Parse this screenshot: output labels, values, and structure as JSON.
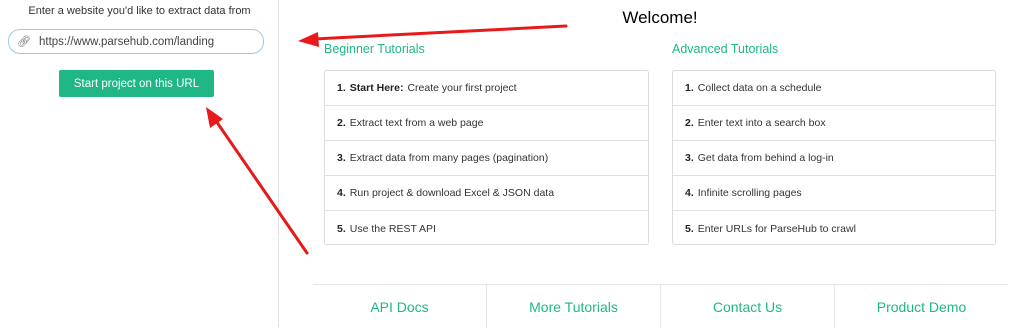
{
  "sidebar": {
    "prompt": "Enter a website you'd like to extract data from",
    "url_value": "https://www.parsehub.com/landing",
    "link_icon": "link-icon",
    "start_button_label": "Start project on this URL"
  },
  "main": {
    "welcome": "Welcome!",
    "beginner": {
      "title": "Beginner Tutorials",
      "items": [
        {
          "num": "1.",
          "strong": "Start Here:",
          "text": "Create your first project"
        },
        {
          "num": "2.",
          "text": "Extract text from a web page"
        },
        {
          "num": "3.",
          "text": "Extract data from many pages (pagination)"
        },
        {
          "num": "4.",
          "text": "Run project & download Excel & JSON data"
        },
        {
          "num": "5.",
          "text": "Use the REST API"
        }
      ]
    },
    "advanced": {
      "title": "Advanced Tutorials",
      "items": [
        {
          "num": "1.",
          "text": "Collect data on a schedule"
        },
        {
          "num": "2.",
          "text": "Enter text into a search box"
        },
        {
          "num": "3.",
          "text": "Get data from behind a log-in"
        },
        {
          "num": "4.",
          "text": "Infinite scrolling pages"
        },
        {
          "num": "5.",
          "text": "Enter URLs for ParseHub to crawl"
        }
      ]
    },
    "bottom_links": [
      "API Docs",
      "More Tutorials",
      "Contact Us",
      "Product Demo"
    ]
  },
  "colors": {
    "accent": "#1fb786",
    "annotation_arrow": "#e8191b"
  }
}
